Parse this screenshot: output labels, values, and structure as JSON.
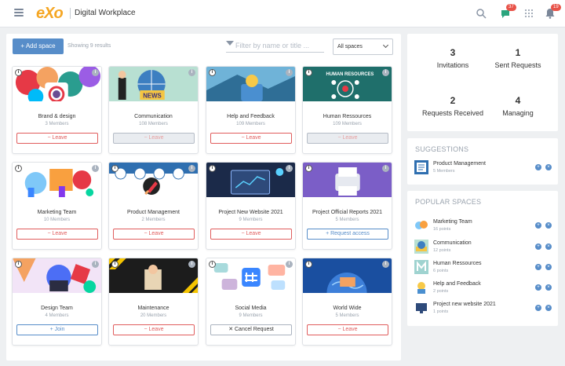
{
  "header": {
    "logo": "eXo",
    "app_title": "Digital Workplace",
    "chat_badge": "37",
    "notif_badge": "19"
  },
  "toolbar": {
    "add_space_label": "+ Add space",
    "results_text": "Showing 9 results",
    "filter_placeholder": "Filter by name or title ...",
    "select_value": "All spaces"
  },
  "spaces": [
    {
      "name": "Brand & design",
      "members": "3 Members",
      "action": "−  Leave"
    },
    {
      "name": "Communication",
      "members": "108 Members",
      "action": "−  Leave"
    },
    {
      "name": "Help and Feedback",
      "members": "109 Members",
      "action": "−  Leave"
    },
    {
      "name": "Human Ressources",
      "members": "109 Members",
      "action": "−  Leave"
    },
    {
      "name": "Marketing Team",
      "members": "10 Members",
      "action": "−  Leave"
    },
    {
      "name": "Product Management",
      "members": "2 Members",
      "action": "−  Leave"
    },
    {
      "name": "Project New Website 2021",
      "members": "9 Members",
      "action": "−  Leave"
    },
    {
      "name": "Project Official Reports 2021",
      "members": "5 Members",
      "action": "+  Request access"
    },
    {
      "name": "Design Team",
      "members": "4 Members",
      "action": "+  Join"
    },
    {
      "name": "Maintenance",
      "members": "20 Members",
      "action": "−  Leave"
    },
    {
      "name": "Social Media",
      "members": "9 Members",
      "action": "✕  Cancel Request"
    },
    {
      "name": "World Wide",
      "members": "5 Members",
      "action": "−  Leave"
    }
  ],
  "banner_text": {
    "hr": "HUMAN RESOURCES",
    "news": "NEWS"
  },
  "stats": {
    "invitations_n": "3",
    "invitations_l": "Invitations",
    "sent_n": "1",
    "sent_l": "Sent Requests",
    "received_n": "2",
    "received_l": "Requests Received",
    "managing_n": "4",
    "managing_l": "Managing"
  },
  "suggestions": {
    "title": "SUGGESTIONS",
    "items": [
      {
        "name": "Product Management",
        "sub": "5 Members"
      }
    ]
  },
  "popular": {
    "title": "POPULAR SPACES",
    "items": [
      {
        "name": "Marketing Team",
        "sub": "16 points"
      },
      {
        "name": "Communication",
        "sub": "12 points"
      },
      {
        "name": "Human Ressources",
        "sub": "6 points"
      },
      {
        "name": "Help and Feedback",
        "sub": "2 points"
      },
      {
        "name": "Project new website 2021",
        "sub": "1 points"
      }
    ]
  },
  "colors": {
    "accent": "#578dc9",
    "leave": "#e05d5d",
    "logo": "#f5a623"
  }
}
